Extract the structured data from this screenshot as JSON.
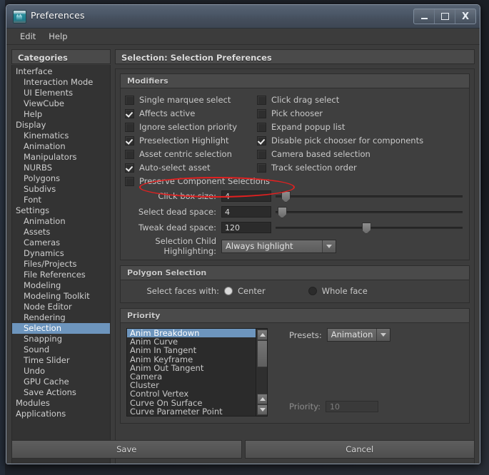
{
  "window": {
    "title": "Preferences",
    "icon": "maya-app-icon",
    "controls": [
      {
        "name": "minimize-button",
        "glyph": "minimize-icon"
      },
      {
        "name": "maximize-button",
        "glyph": "maximize-icon"
      },
      {
        "name": "close-button",
        "glyph": "close-icon",
        "label": "X"
      }
    ]
  },
  "menubar": {
    "items": [
      {
        "label": "Edit"
      },
      {
        "label": "Help"
      }
    ]
  },
  "categories": {
    "header": "Categories",
    "selected": "Selection",
    "items": [
      {
        "label": "Interface",
        "level": 0
      },
      {
        "label": "Interaction Mode",
        "level": 1
      },
      {
        "label": "UI Elements",
        "level": 1
      },
      {
        "label": "ViewCube",
        "level": 1
      },
      {
        "label": "Help",
        "level": 1
      },
      {
        "label": "Display",
        "level": 0
      },
      {
        "label": "Kinematics",
        "level": 1
      },
      {
        "label": "Animation",
        "level": 1
      },
      {
        "label": "Manipulators",
        "level": 1
      },
      {
        "label": "NURBS",
        "level": 1
      },
      {
        "label": "Polygons",
        "level": 1
      },
      {
        "label": "Subdivs",
        "level": 1
      },
      {
        "label": "Font",
        "level": 1
      },
      {
        "label": "Settings",
        "level": 0
      },
      {
        "label": "Animation",
        "level": 1
      },
      {
        "label": "Assets",
        "level": 1
      },
      {
        "label": "Cameras",
        "level": 1
      },
      {
        "label": "Dynamics",
        "level": 1
      },
      {
        "label": "Files/Projects",
        "level": 1
      },
      {
        "label": "File References",
        "level": 1
      },
      {
        "label": "Modeling",
        "level": 1
      },
      {
        "label": "Modeling Toolkit",
        "level": 1
      },
      {
        "label": "Node Editor",
        "level": 1
      },
      {
        "label": "Rendering",
        "level": 1
      },
      {
        "label": "Selection",
        "level": 1
      },
      {
        "label": "Snapping",
        "level": 1
      },
      {
        "label": "Sound",
        "level": 1
      },
      {
        "label": "Time Slider",
        "level": 1
      },
      {
        "label": "Undo",
        "level": 1
      },
      {
        "label": "GPU Cache",
        "level": 1
      },
      {
        "label": "Save Actions",
        "level": 1
      },
      {
        "label": "Modules",
        "level": 0
      },
      {
        "label": "Applications",
        "level": 0
      }
    ]
  },
  "right_header": "Selection: Selection Preferences",
  "modifiers": {
    "title": "Modifiers",
    "checkboxes_left": [
      {
        "label": "Single marquee select",
        "checked": false
      },
      {
        "label": "Affects active",
        "checked": true
      },
      {
        "label": "Ignore selection priority",
        "checked": false
      },
      {
        "label": "Preselection Highlight",
        "checked": true
      },
      {
        "label": "Asset centric selection",
        "checked": false
      },
      {
        "label": "Auto-select asset",
        "checked": true
      },
      {
        "label": "Preserve Component Selections",
        "checked": false
      }
    ],
    "checkboxes_right": [
      {
        "label": "Click drag select",
        "checked": false
      },
      {
        "label": "Pick chooser",
        "checked": false
      },
      {
        "label": "Expand popup list",
        "checked": false
      },
      {
        "label": "Disable pick chooser for components",
        "checked": true
      },
      {
        "label": "Camera based selection",
        "checked": false
      },
      {
        "label": "Track selection order",
        "checked": false
      }
    ],
    "sliders": [
      {
        "label": "Click box size:",
        "value": "4",
        "thumb_pct": 3
      },
      {
        "label": "Select dead space:",
        "value": "4",
        "thumb_pct": 1
      },
      {
        "label": "Tweak dead space:",
        "value": "120",
        "thumb_pct": 46
      }
    ],
    "child_highlighting": {
      "label": "Selection Child Highlighting:",
      "value": "Always highlight"
    }
  },
  "polygon_selection": {
    "title": "Polygon Selection",
    "lead_label": "Select faces with:",
    "options": [
      {
        "label": "Center",
        "selected": true
      },
      {
        "label": "Whole face",
        "selected": false
      }
    ]
  },
  "priority": {
    "title": "Priority",
    "selected_item": "Anim Breakdown",
    "list": [
      "Anim Breakdown",
      "Anim Curve",
      "Anim In Tangent",
      "Anim Keyframe",
      "Anim Out Tangent",
      "Camera",
      "Cluster",
      "Control Vertex",
      "Curve On Surface",
      "Curve Parameter Point"
    ],
    "presets_label": "Presets:",
    "presets_value": "Animation",
    "priority_label": "Priority:",
    "priority_value": "10"
  },
  "footer": {
    "save_label": "Save",
    "cancel_label": "Cancel"
  },
  "annotation": {
    "type": "red-ellipse-highlight",
    "target": "Preserve Component Selections",
    "color": "#e32020"
  },
  "colors": {
    "selection_blue": "#6d95bd",
    "panel_bg": "#3c3c3c",
    "group_bg": "#3f3f3f",
    "header_bg": "#4a4a4a",
    "text": "#c9c9c9",
    "annotation_red": "#e32020"
  }
}
